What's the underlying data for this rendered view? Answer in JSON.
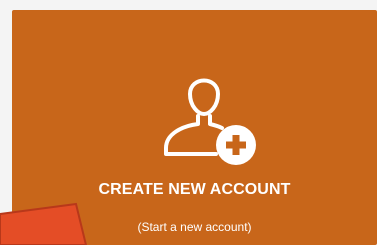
{
  "colors": {
    "card_background": "#c8661a",
    "text": "#ffffff",
    "pointer_fill": "#e44d26",
    "pointer_stroke": "#b8381a"
  },
  "card": {
    "icon": "add-user-icon",
    "title": "CREATE NEW ACCOUNT",
    "subtitle": "(Start a new account)"
  },
  "pointer": {
    "icon": "arrow-pointer-icon"
  }
}
